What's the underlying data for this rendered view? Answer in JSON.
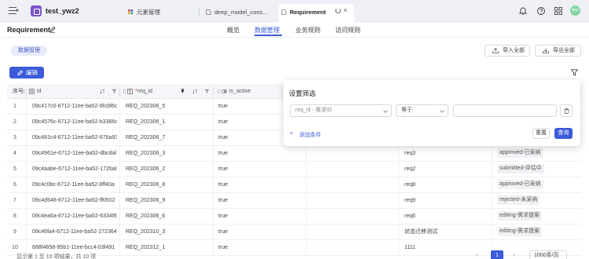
{
  "topbar": {
    "project_name": "test_ywz2",
    "tabs": [
      {
        "label": "元素管理",
        "icon": "grid-icon"
      },
      {
        "label": "deep_model_cons...",
        "icon": "file-icon"
      },
      {
        "label": "Requirement",
        "icon": "file-icon",
        "active": true
      }
    ],
    "avatar_text": "hao",
    "accent_color": "#3b5bdb"
  },
  "header": {
    "title": "Requirement",
    "nav_tabs": [
      "概览",
      "数据管理",
      "业务规则",
      "访问规则"
    ],
    "active_nav": "数据管理"
  },
  "toolbar": {
    "chip_label": "数据管理",
    "import_label": "导入全部",
    "export_label": "导出全部",
    "edit_label": "编辑"
  },
  "table": {
    "columns": [
      {
        "label": "序号"
      },
      {
        "label": "id",
        "type_icon": "hash-icon"
      },
      {
        "label": "req_id",
        "type_icon": "text-type-icon",
        "required": "*"
      },
      {
        "label": "is_active",
        "type_icon": "boolean-icon"
      }
    ],
    "rows": [
      {
        "index": "1",
        "id": "09c417c0-6712-11ee-ba52-6fcbf6c",
        "req_id": "REQ_202306_5",
        "is_active": "true",
        "c5": "",
        "c6": "",
        "c7": ""
      },
      {
        "index": "2",
        "id": "09c4576c-6712-11ee-ba52-b3386c",
        "req_id": "REQ_202306_1",
        "is_active": "true",
        "c5": "",
        "c6": "",
        "c7": ""
      },
      {
        "index": "3",
        "id": "09c481c4-6712-11ee-ba52-876a93",
        "req_id": "REQ_202306_7",
        "is_active": "true",
        "c5": "",
        "c6": "",
        "c7": ""
      },
      {
        "index": "4",
        "id": "09c4961e-6712-11ee-ba52-dbcdal",
        "req_id": "REQ_202306_3",
        "is_active": "true",
        "c5": "",
        "c6": "req3",
        "c7": "approved-已采纳"
      },
      {
        "index": "5",
        "id": "09c4aabe-6712-11ee-ba52-172ba0",
        "req_id": "REQ_202306_2",
        "is_active": "true",
        "c5": "",
        "c6": "req2",
        "c7": "submitted-评估中"
      },
      {
        "index": "6",
        "id": "09c4c0bc-6712-11ee-ba52-8ff40a",
        "req_id": "REQ_202306_8",
        "is_active": "true",
        "c5": "",
        "c6": "req8",
        "c7": "approved-已采纳"
      },
      {
        "index": "7",
        "id": "09c4d548-6712-11ee-ba52-ff0502",
        "req_id": "REQ_202306_9",
        "is_active": "true",
        "c5": "",
        "c6": "req9",
        "c7": "rejected-未采纳"
      },
      {
        "index": "8",
        "id": "09c4ea6a-6712-11ee-ba52-6334f8",
        "req_id": "REQ_202306_6",
        "is_active": "true",
        "c5": "",
        "c6": "req6",
        "c7": "editing-需求提案"
      },
      {
        "index": "9",
        "id": "09c46fa4-6712-11ee-ba52-272364",
        "req_id": "REQ_202310_3",
        "is_active": "true",
        "c5": "",
        "c6": "状态迁移测试",
        "c7": "editing-需求提案"
      },
      {
        "index": "10",
        "id": "688f4658-95b1-11ee-bcc4-03f491",
        "req_id": "REQ_202312_1",
        "is_active": "true",
        "c5": "",
        "c6": "1111",
        "c7": ""
      }
    ]
  },
  "pagination": {
    "summary": "显示第 1 至 10 项结果，共 10 项",
    "current_page": "1",
    "page_size": "1000条/页"
  },
  "filter_panel": {
    "title": "设置筛选",
    "field_value": "req_id - 需求ID",
    "operator_value": "等于",
    "value_placeholder": "",
    "add_label": "添加条件",
    "reset_label": "重置",
    "query_label": "查询"
  }
}
